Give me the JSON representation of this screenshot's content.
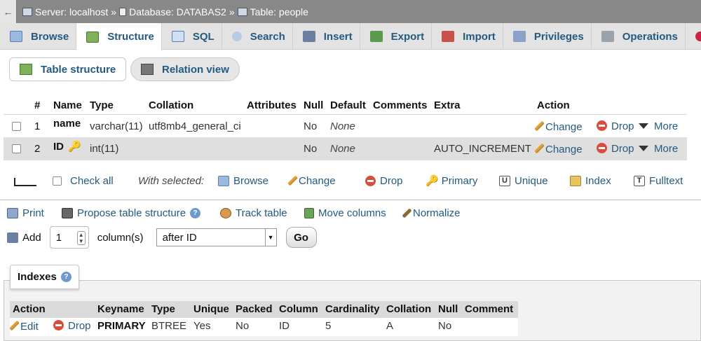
{
  "breadcrumb": {
    "back": "←",
    "server": "Server: localhost",
    "database": "Database: DATABAS2",
    "table": "Table: people",
    "sep": "»"
  },
  "tabs": [
    "Browse",
    "Structure",
    "SQL",
    "Search",
    "Insert",
    "Export",
    "Import",
    "Privileges",
    "Operations"
  ],
  "subtabs": {
    "table_structure": "Table structure",
    "relation_view": "Relation view"
  },
  "columns_header": [
    "#",
    "Name",
    "Type",
    "Collation",
    "Attributes",
    "Null",
    "Default",
    "Comments",
    "Extra",
    "Action"
  ],
  "rows": [
    {
      "num": "1",
      "name": "name",
      "type": "varchar(11)",
      "collation": "utf8mb4_general_ci",
      "attributes": "",
      "null": "No",
      "default": "None",
      "comments": "",
      "extra": "",
      "change": "Change",
      "drop": "Drop",
      "more": "More"
    },
    {
      "num": "2",
      "name": "ID",
      "type": "int(11)",
      "collation": "",
      "attributes": "",
      "null": "No",
      "default": "None",
      "comments": "",
      "extra": "AUTO_INCREMENT",
      "change": "Change",
      "drop": "Drop",
      "more": "More"
    }
  ],
  "bulk": {
    "check_all": "Check all",
    "with_selected": "With selected:",
    "browse": "Browse",
    "change": "Change",
    "drop": "Drop",
    "primary": "Primary",
    "unique": "Unique",
    "index": "Index",
    "fulltext": "Fulltext"
  },
  "actions": {
    "print": "Print",
    "propose": "Propose table structure",
    "track": "Track table",
    "move": "Move columns",
    "normalize": "Normalize"
  },
  "add": {
    "label": "Add",
    "count": "1",
    "columns": "column(s)",
    "position": "after ID",
    "go": "Go"
  },
  "indexes": {
    "title": "Indexes",
    "headers": [
      "Action",
      "Keyname",
      "Type",
      "Unique",
      "Packed",
      "Column",
      "Cardinality",
      "Collation",
      "Null",
      "Comment"
    ],
    "row": {
      "edit": "Edit",
      "drop": "Drop",
      "keyname": "PRIMARY",
      "type": "BTREE",
      "unique": "Yes",
      "packed": "No",
      "column": "ID",
      "cardinality": "5",
      "collation": "A",
      "null": "No",
      "comment": ""
    }
  }
}
